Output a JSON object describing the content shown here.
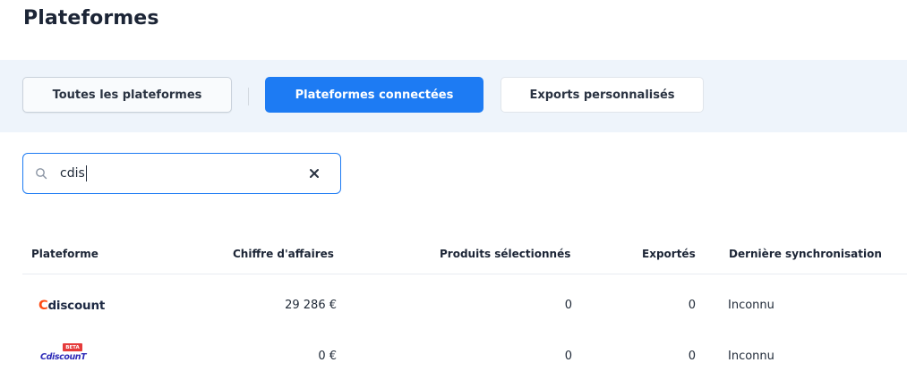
{
  "page": {
    "title": "Plateformes"
  },
  "tabs": [
    {
      "label": "Toutes les plateformes",
      "active": false
    },
    {
      "label": "Plateformes connectées",
      "active": true
    },
    {
      "label": "Exports personnalisés",
      "active": false
    }
  ],
  "search": {
    "value": "cdis"
  },
  "table": {
    "headers": {
      "platform": "Plateforme",
      "revenue": "Chiffre d'affaires",
      "selected": "Produits sélectionnés",
      "exported": "Exportés",
      "last_sync": "Dernière synchronisation"
    },
    "rows": [
      {
        "logo_text": "Cdiscount",
        "logo_rest": "discount",
        "logo_first": "C",
        "revenue": "29 286 €",
        "selected": "0",
        "exported": "0",
        "last_sync": "Inconnu"
      },
      {
        "badge": "BETA",
        "logo_text": "CdiscounT",
        "revenue": "0 €",
        "selected": "0",
        "exported": "0",
        "last_sync": "Inconnu"
      }
    ]
  },
  "colors": {
    "accent": "#1d7bf3",
    "band": "#eef4fb",
    "cdiscount_c": "#ff4b14",
    "beta_badge": "#e53b3b"
  }
}
